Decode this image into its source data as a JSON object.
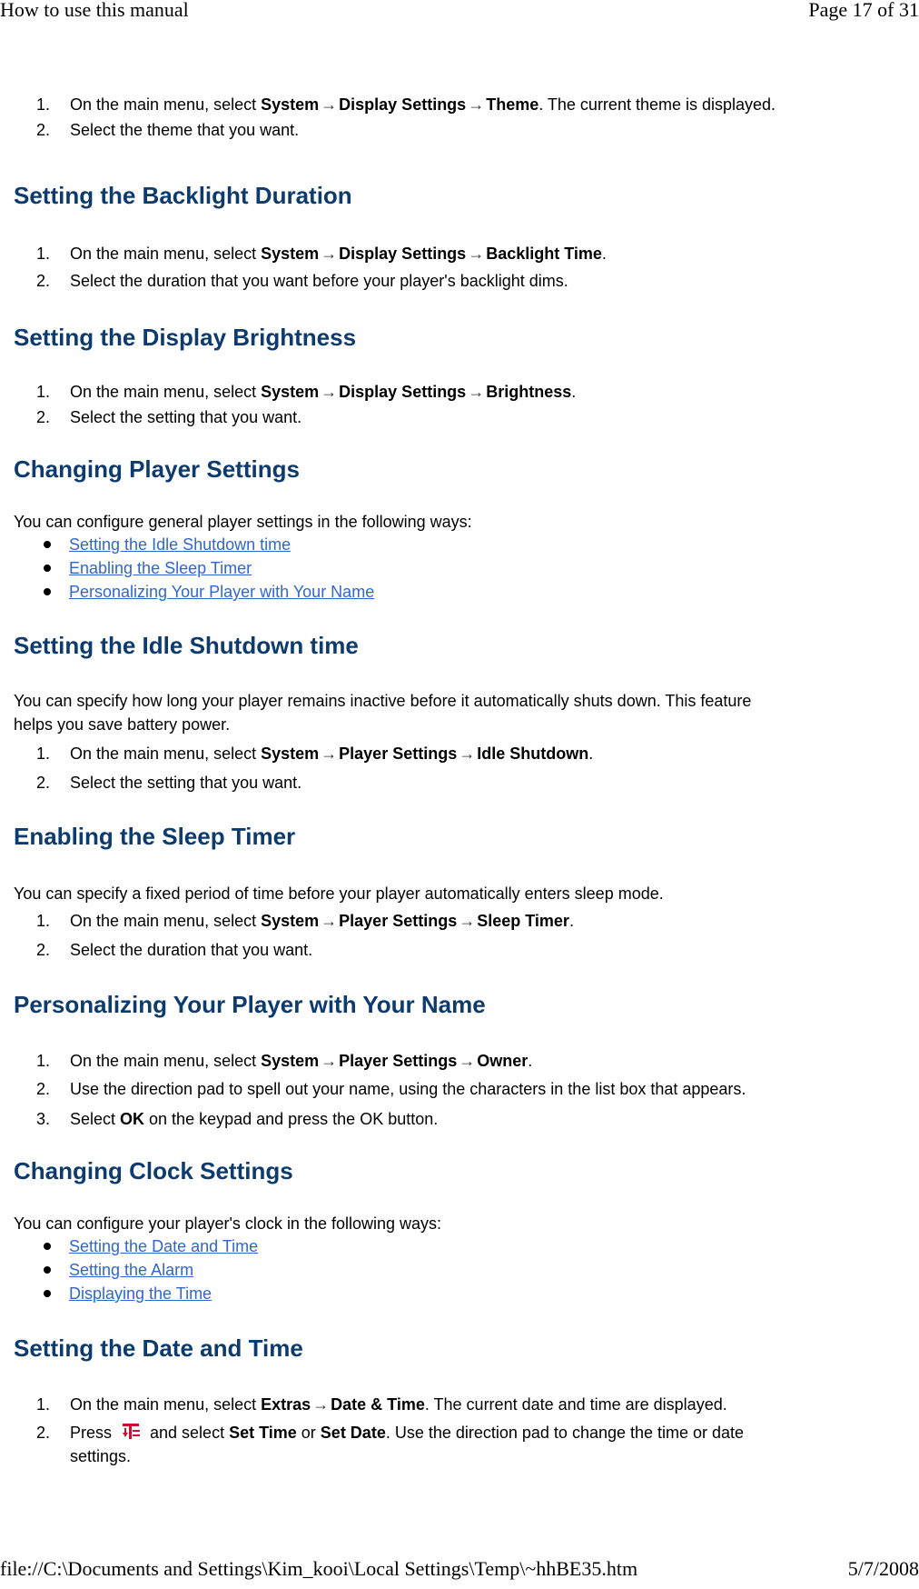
{
  "header": {
    "title": "How to use this manual",
    "page": "Page 17 of 31"
  },
  "footer": {
    "path": "file://C:\\Documents and Settings\\Kim_kooi\\Local Settings\\Temp\\~hhBE35.htm",
    "date": "5/7/2008"
  },
  "arrow": "→",
  "common": {
    "on_main_menu": "On the main menu, select "
  },
  "theme": {
    "steps": [
      {
        "num": "1.",
        "menu": [
          "System",
          "Display Settings",
          "Theme"
        ],
        "suffix": ". The current theme is displayed."
      },
      {
        "num": "2.",
        "text": "Select the theme that you want."
      }
    ]
  },
  "backlight": {
    "title": "Setting the Backlight Duration",
    "steps": [
      {
        "num": "1.",
        "menu": [
          "System",
          "Display Settings",
          "Backlight Time"
        ],
        "suffix": "."
      },
      {
        "num": "2.",
        "text": "Select the duration that you want before your player's backlight dims."
      }
    ]
  },
  "brightness": {
    "title": "Setting the Display Brightness",
    "steps": [
      {
        "num": "1.",
        "menu": [
          "System",
          "Display Settings",
          "Brightness"
        ],
        "suffix": "."
      },
      {
        "num": "2.",
        "text": "Select the setting that you want."
      }
    ]
  },
  "player_settings": {
    "title": "Changing Player Settings",
    "intro": "You can configure general player settings in the following ways:",
    "links": [
      "Setting the Idle Shutdown time",
      "Enabling the Sleep Timer",
      "Personalizing Your Player with Your Name"
    ]
  },
  "idle": {
    "title": "Setting the Idle Shutdown time",
    "intro_line1": "You can specify how long your player remains inactive before it automatically shuts down. This feature",
    "intro_line2": "helps you save battery power.",
    "steps": [
      {
        "num": "1.",
        "menu": [
          "System",
          "Player Settings",
          "Idle Shutdown"
        ],
        "suffix": "."
      },
      {
        "num": "2.",
        "text": "Select the setting that you want."
      }
    ]
  },
  "sleep": {
    "title": "Enabling the Sleep Timer",
    "intro": "You can specify a fixed period of time before your player automatically enters sleep mode.",
    "steps": [
      {
        "num": "1.",
        "menu": [
          "System",
          "Player Settings",
          "Sleep Timer"
        ],
        "suffix": "."
      },
      {
        "num": "2.",
        "text": "Select the duration that you want."
      }
    ]
  },
  "owner": {
    "title": "Personalizing Your Player with Your Name",
    "steps": [
      {
        "num": "1.",
        "menu": [
          "System",
          "Player Settings",
          "Owner"
        ],
        "suffix": "."
      },
      {
        "num": "2.",
        "text": "Use the direction pad to spell out your name, using the characters in the list box that appears."
      },
      {
        "num": "3.",
        "pre": "Select ",
        "bold": "OK",
        "post": " on the keypad and press the OK button."
      }
    ]
  },
  "clock": {
    "title": "Changing Clock Settings",
    "intro": "You can configure your player's clock in the following ways:",
    "links": [
      "Setting the Date and Time",
      "Setting the Alarm",
      "Displaying the Time"
    ]
  },
  "datetime": {
    "title": "Setting the Date and Time",
    "steps": [
      {
        "num": "1.",
        "menu": [
          "Extras",
          "Date & Time"
        ],
        "suffix": ". The current date and time are displayed."
      },
      {
        "num": "2.",
        "pre": "Press ",
        "icon": "menu-options-icon",
        "mid": " and select ",
        "bold1": "Set Time",
        "or": " or ",
        "bold2": "Set Date",
        "post_line1": ". Use the direction pad to change the time or date",
        "post_line2": "settings."
      }
    ]
  },
  "colors": {
    "heading": "#0d3b6e",
    "link": "#3366cc",
    "icon": "#c8102e"
  }
}
